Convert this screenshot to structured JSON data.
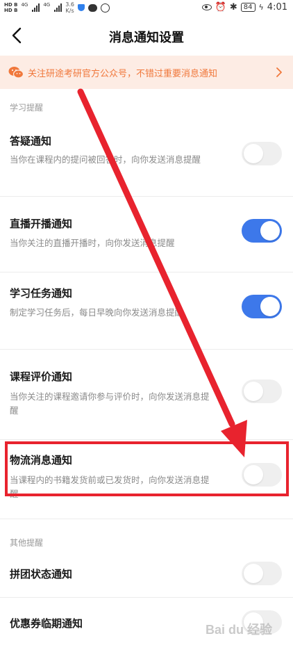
{
  "status_bar": {
    "hd_top": "HD B",
    "hd_bottom": "HD B",
    "net1": "4G",
    "net2": "4G",
    "speed_value": "3.6",
    "speed_unit": "K/s",
    "battery": "84",
    "time": "4:01"
  },
  "nav": {
    "title": "消息通知设置"
  },
  "banner": {
    "text": "关注研途考研官方公众号，不错过重要消息通知"
  },
  "sections": {
    "study_label": "学习提醒",
    "other_label": "其他提醒"
  },
  "rows": [
    {
      "title": "答疑通知",
      "desc": "当你在课程内的提问被回答时，向你发送消息提醒",
      "enabled": false
    },
    {
      "title": "直播开播通知",
      "desc": "当你关注的直播开播时，向你发送消息提醒",
      "enabled": true
    },
    {
      "title": "学习任务通知",
      "desc": "制定学习任务后，每日早晚向你发送消息提醒",
      "enabled": true
    },
    {
      "title": "课程评价通知",
      "desc": "当你关注的课程邀请你参与评价时，向你发送消息提醒",
      "enabled": false
    },
    {
      "title": "物流消息通知",
      "desc": "当课程内的书籍发货前或已发货时，向你发送消息提醒",
      "enabled": false
    },
    {
      "title": "拼团状态通知",
      "desc": "",
      "enabled": false
    },
    {
      "title": "优惠券临期通知",
      "desc": "",
      "enabled": false
    }
  ],
  "watermark": "Bai du 经验",
  "colors": {
    "accent_blue": "#3d78ea",
    "banner_bg": "#fdece4",
    "banner_text": "#f0783c",
    "annotation_red": "#e8232e"
  }
}
